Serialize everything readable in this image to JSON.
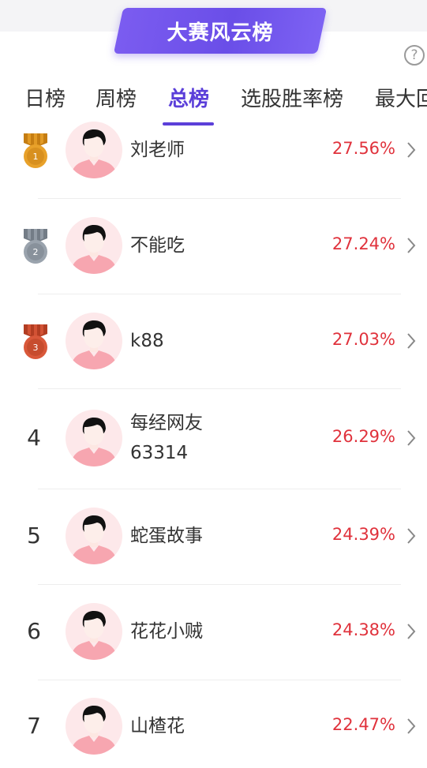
{
  "banner": {
    "title": "大赛风云榜"
  },
  "help": {
    "label": "?"
  },
  "tabs": [
    {
      "label": "日榜",
      "active": false
    },
    {
      "label": "周榜",
      "active": false
    },
    {
      "label": "总榜",
      "active": true
    },
    {
      "label": "选股胜率榜",
      "active": false
    },
    {
      "label": "最大回",
      "active": false
    }
  ],
  "colors": {
    "accent": "#5b3fd9",
    "positive": "#e0323c",
    "gold": "#e8a12a",
    "silver": "#9aa3ad",
    "bronze": "#d9583a"
  },
  "ranking": [
    {
      "rank": "1",
      "medal": "gold",
      "name_lines": [
        "刘老师"
      ],
      "return": "27.56%"
    },
    {
      "rank": "2",
      "medal": "silver",
      "name_lines": [
        "不能吃"
      ],
      "return": "27.24%"
    },
    {
      "rank": "3",
      "medal": "bronze",
      "name_lines": [
        "k88"
      ],
      "return": "27.03%"
    },
    {
      "rank": "4",
      "medal": "",
      "name_lines": [
        "每经网友",
        "63314"
      ],
      "return": "26.29%"
    },
    {
      "rank": "5",
      "medal": "",
      "name_lines": [
        "蛇蛋故事"
      ],
      "return": "24.39%"
    },
    {
      "rank": "6",
      "medal": "",
      "name_lines": [
        "花花小贼"
      ],
      "return": "24.38%"
    },
    {
      "rank": "7",
      "medal": "",
      "name_lines": [
        "山楂花"
      ],
      "return": "22.47%"
    }
  ]
}
